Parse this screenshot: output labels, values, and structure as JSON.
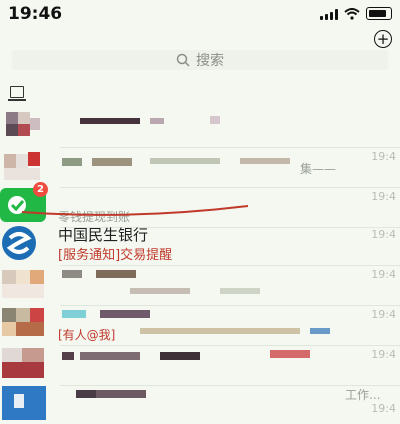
{
  "status_bar": {
    "time": "19:46"
  },
  "header": {
    "plus_label": "+"
  },
  "search": {
    "placeholder": "搜索"
  },
  "chats": [
    {
      "time": ""
    },
    {
      "title": "",
      "subtitle": "",
      "time": "19:4"
    },
    {
      "title": "",
      "subtitle": "零钱提现到账",
      "badge": "2",
      "time": "19:4"
    },
    {
      "title": "中国民生银行",
      "subtitle": "[服务通知]交易提醒",
      "time": "19:4"
    },
    {
      "time": "19:4"
    },
    {
      "title": "",
      "subtitle": "[有人@我]",
      "time": "19:4"
    },
    {
      "time": "19:4"
    },
    {
      "subtitle": "工作...",
      "time": "19:4"
    }
  ],
  "colors": {
    "wechat_green": "#21b845",
    "badge_red": "#f04b3f",
    "bank_blue": "#1d6db5"
  }
}
